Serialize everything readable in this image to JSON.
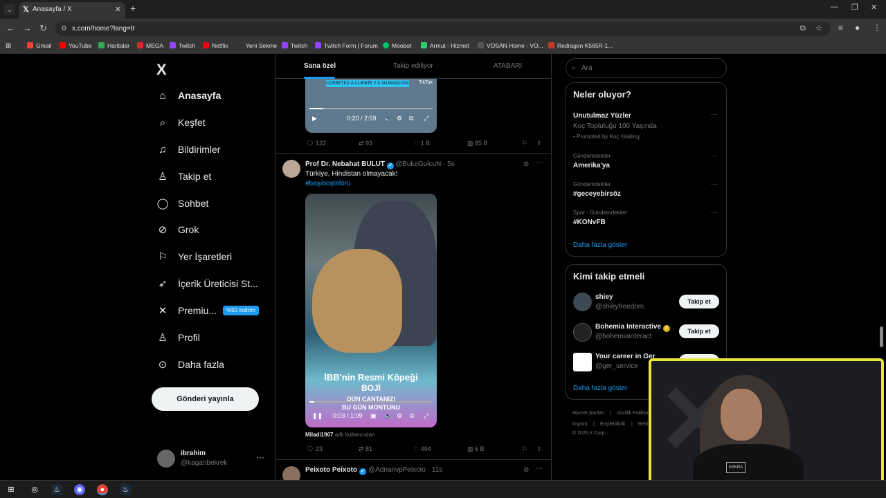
{
  "browser": {
    "tab_title": "Anasayfa / X",
    "url": "x.com/home?lang=tr",
    "bookmarks": [
      "Gmail",
      "YouTube",
      "Haritalar",
      "MEGA",
      "Twitch",
      "Netflix",
      "Yeni Sekme",
      "Twitch",
      "Twitch Form | Forum",
      "Moobot",
      "Armut - Hizmet",
      "VOSAN Home - VO...",
      "Redragon K565R-1..."
    ],
    "bookmark_colors": [
      "#ea4335",
      "#ff0000",
      "#34a853",
      "#d9272e",
      "#9146ff",
      "#e50914",
      "#888888",
      "#9146ff",
      "#9146ff",
      "#00c16a",
      "#2ecc71",
      "#555555",
      "#c0392b"
    ]
  },
  "sidebar": {
    "logo": "X",
    "items": [
      {
        "label": "Anasayfa",
        "icon": "home-icon",
        "glyph": "⌂"
      },
      {
        "label": "Keşfet",
        "icon": "search-icon",
        "glyph": "⌕"
      },
      {
        "label": "Bildirimler",
        "icon": "bell-icon",
        "glyph": "🔔"
      },
      {
        "label": "Takip et",
        "icon": "person-add-icon",
        "glyph": "👤"
      },
      {
        "label": "Sohbet",
        "icon": "chat-icon",
        "glyph": "💬"
      },
      {
        "label": "Grok",
        "icon": "grok-icon",
        "glyph": "⊘"
      },
      {
        "label": "Yer İşaretleri",
        "icon": "bookmark-icon",
        "glyph": "🔖"
      },
      {
        "label": "İçerik Üreticisi St...",
        "icon": "rocket-icon",
        "glyph": "🚀"
      },
      {
        "label": "Premiu...",
        "icon": "x-premium-icon",
        "glyph": "𝕏"
      },
      {
        "label": "Profil",
        "icon": "profile-icon",
        "glyph": "👤"
      },
      {
        "label": "Daha fazla",
        "icon": "more-circle-icon",
        "glyph": "⋯"
      }
    ],
    "premium_badge": "%50 indirim",
    "post_button": "Gönderi yayınla",
    "account_name": "ibrahim",
    "account_handle": "@kaganbekrek"
  },
  "timeline": {
    "tabs": [
      "Sana özel",
      "Takip ediliyor",
      "ATABARI"
    ],
    "post1": {
      "video_text": "CORRETEO A CLIENTE Y A SU MASCOTA",
      "tiktok": "TikTok",
      "time": "0:20 / 2:59",
      "progress": 0.11,
      "replies": "122",
      "reposts": "93",
      "likes": "1 B",
      "views": "85 B"
    },
    "post2": {
      "name": "Prof Dr. Nebahat BULUT",
      "handle": "@BulutGulcuN · 5s",
      "text": "Türkiye, Hindistan olmayacak!",
      "hashtag": "#başıboştelörü",
      "video_title1": "İBB'nin Resmi Köpeği",
      "video_title2": "BOJİ",
      "video_sub1": "DÜN ÇANTANIZI",
      "video_sub2": "BU GÜN MONTUNU",
      "time": "0:03 / 1:09",
      "progress": 0.04,
      "caption_user": "Miladi1907",
      "caption_rest": "adlı kullanıcıdan",
      "replies": "23",
      "reposts": "81",
      "likes": "494",
      "views": "6 B"
    },
    "post3": {
      "name": "Peixoto Peixoto",
      "handle": "@AdnanvpPeixoto · 11s"
    }
  },
  "right": {
    "search_placeholder": "Ara",
    "trends_title": "Neler oluyor?",
    "promo_title": "Unutulmaz Yüzler",
    "promo_sub": "Koç Topluluğu 100 Yaşında",
    "promo_meta": "Promoted by Koç Holding",
    "trends": [
      {
        "meta": "Gündemdekiler",
        "title": "Amerika'ya"
      },
      {
        "meta": "Gündemdekiler",
        "title": "#geceyebirsöz"
      },
      {
        "meta": "Spor · Gündemdekiler",
        "title": "#KONvFB"
      }
    ],
    "show_more": "Daha fazla göster",
    "wtf_title": "Kimi takip etmeli",
    "follow_label": "Takip et",
    "wtf": [
      {
        "name": "shiey",
        "handle": "@shieyfreedom"
      },
      {
        "name": "Bohemia Interactive",
        "handle": "@bohemiainteract"
      },
      {
        "name": "Your career in Ger",
        "handle": "@ger_service"
      }
    ],
    "wtf_more": "Daha fazla göster",
    "footer1": [
      "Hizmet Şartları",
      "|",
      "Gizlilik Politikası"
    ],
    "footer2": [
      "Imprint",
      "|",
      "Erişilebilirlik",
      "|",
      "Rekl"
    ],
    "copyright": "© 2026 X Corp."
  },
  "webcam": {
    "shirt_text": "KEKRA"
  }
}
